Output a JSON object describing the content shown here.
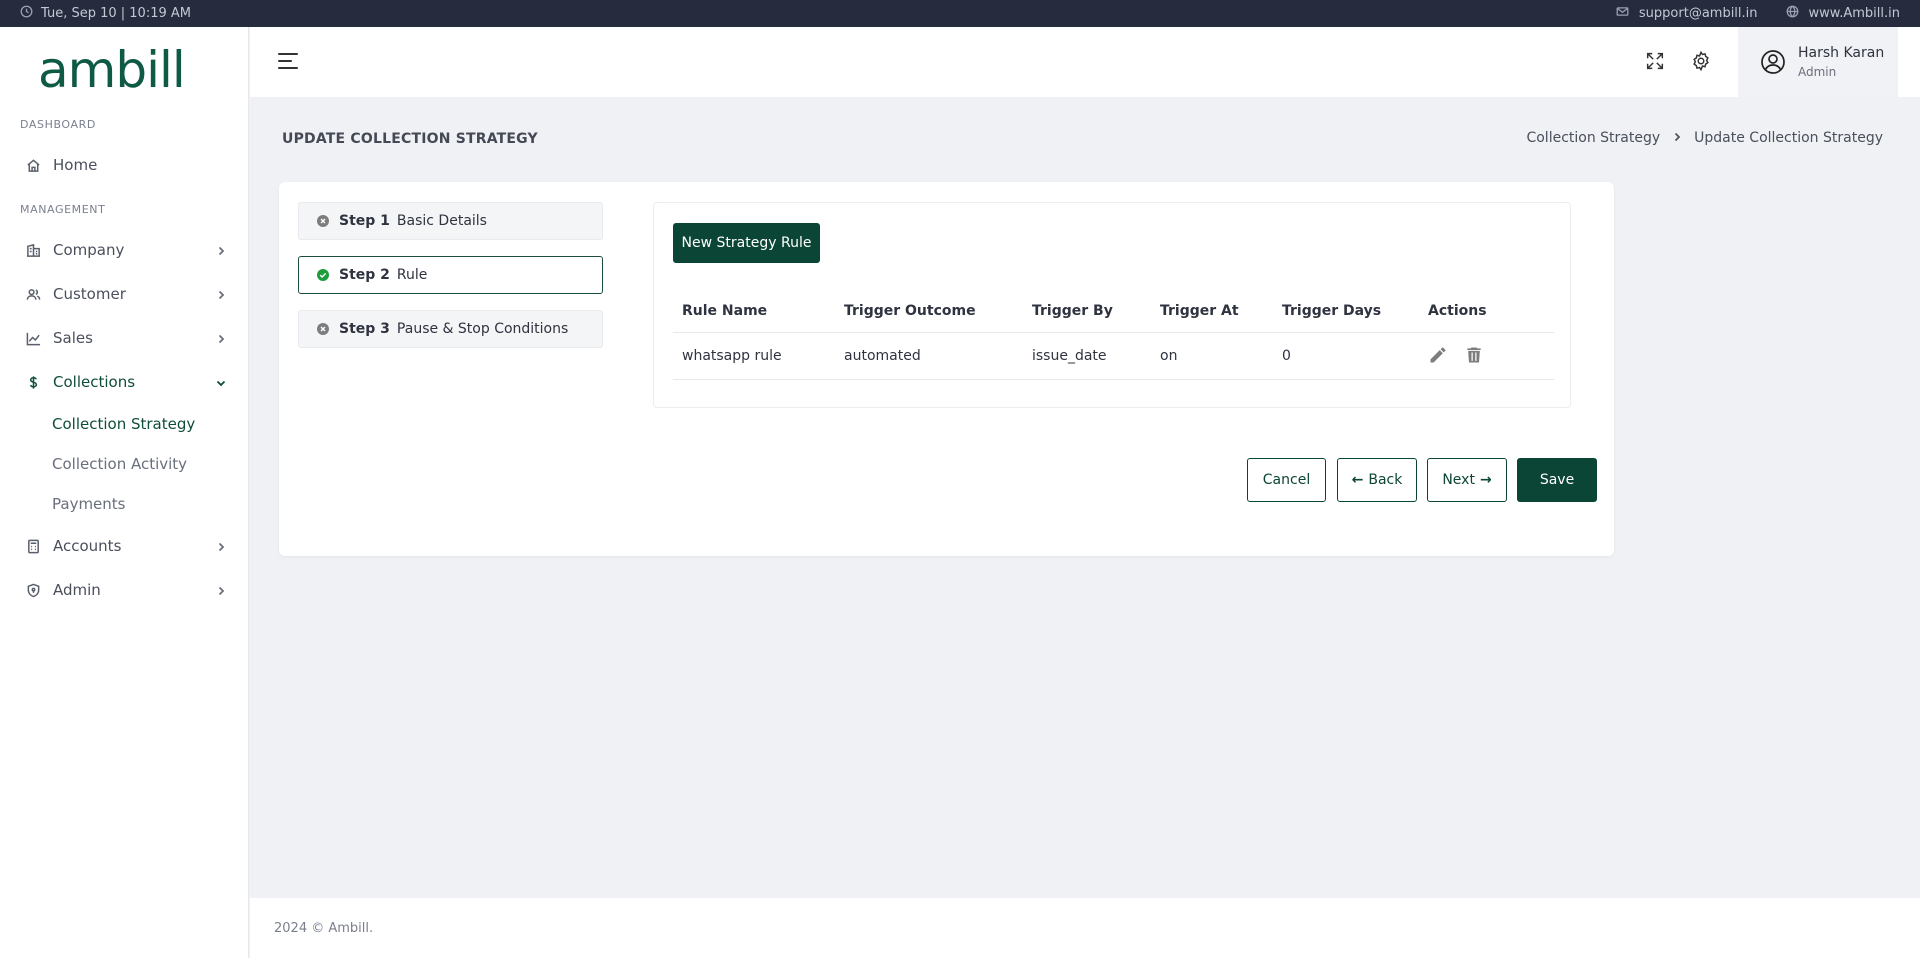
{
  "topbar": {
    "datetime": "Tue, Sep 10 | 10:19 AM",
    "email": "support@ambill.in",
    "website": "www.Ambill.in"
  },
  "brand": {
    "logo_text": "ambill",
    "color": "#0e5a45"
  },
  "sidebar": {
    "section_dashboard": "DASHBOARD",
    "section_management": "MANAGEMENT",
    "home": "Home",
    "company": "Company",
    "customer": "Customer",
    "sales": "Sales",
    "collections": "Collections",
    "collection_strategy": "Collection Strategy",
    "collection_activity": "Collection Activity",
    "payments": "Payments",
    "accounts": "Accounts",
    "admin": "Admin"
  },
  "user": {
    "name": "Harsh Karan",
    "role": "Admin"
  },
  "page": {
    "title": "UPDATE COLLECTION STRATEGY",
    "breadcrumb": [
      "Collection Strategy",
      "Update Collection Strategy"
    ]
  },
  "steps": [
    {
      "num": "Step 1",
      "label": "Basic Details",
      "state": "incomplete"
    },
    {
      "num": "Step 2",
      "label": "Rule",
      "state": "active"
    },
    {
      "num": "Step 3",
      "label": "Pause & Stop Conditions",
      "state": "incomplete"
    }
  ],
  "rules": {
    "new_button": "New Strategy Rule",
    "columns": [
      "Rule Name",
      "Trigger Outcome",
      "Trigger By",
      "Trigger At",
      "Trigger Days",
      "Actions"
    ],
    "rows": [
      {
        "rule_name": "whatsapp rule",
        "trigger_outcome": "automated",
        "trigger_by": "issue_date",
        "trigger_at": "on",
        "trigger_days": "0"
      }
    ]
  },
  "actions": {
    "cancel": "Cancel",
    "back": "Back",
    "next": "Next",
    "save": "Save"
  },
  "footer": {
    "text": "2024 © Ambill."
  },
  "colors": {
    "primary": "#0b4535",
    "topbar": "#262b3e",
    "success": "#1f9d3a",
    "muted": "#7d7d7d"
  }
}
